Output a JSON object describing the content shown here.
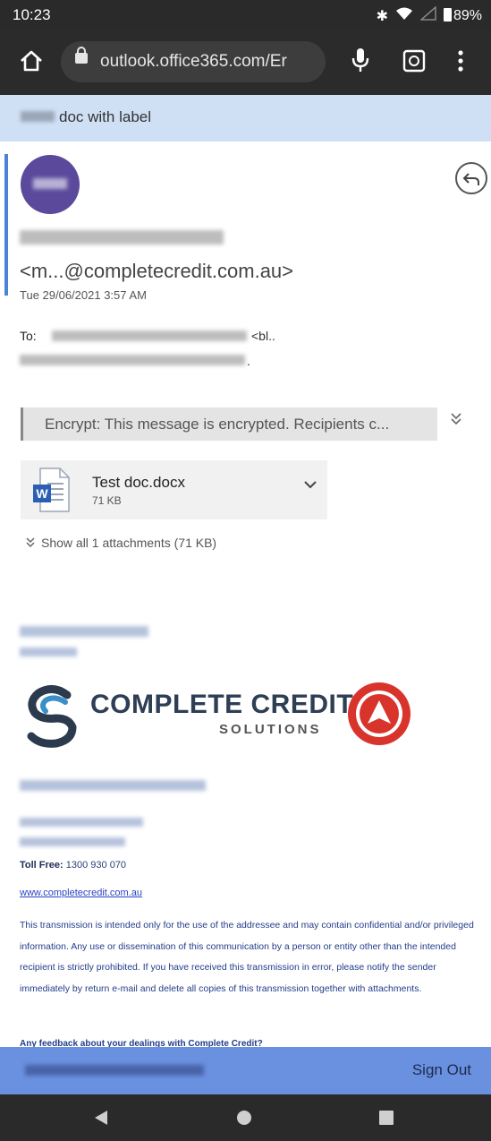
{
  "status_bar": {
    "time": "10:23",
    "battery": "89%",
    "icons": [
      "bluetooth-icon",
      "wifi-icon",
      "signal-icon",
      "battery-icon"
    ]
  },
  "browser": {
    "url": "outlook.office365.com/Er",
    "icons": [
      "home-icon",
      "lock-icon",
      "mic-icon",
      "tab-switcher-icon",
      "more-menu-icon"
    ]
  },
  "email": {
    "subject_suffix": "doc with label",
    "sender_email": "<m...@completecredit.com.au>",
    "date": "Tue 29/06/2021 3:57 AM",
    "to_label": "To:",
    "to_suffix": "<bl..",
    "to_trailing": ".",
    "encrypt_notice": "Encrypt: This message is encrypted. Recipients c...",
    "attachment": {
      "name": "Test doc.docx",
      "size": "71 KB"
    },
    "show_all": "Show all 1 attachments (71 KB)"
  },
  "signature": {
    "logo_line1": "COMPLETE CREDIT",
    "logo_line2": "SOLUTIONS",
    "toll_free_label": "Toll Free:",
    "toll_free_number": "1300 930 070",
    "website": "www.completecredit.com.au",
    "disclaimer": "This transmission is intended only for the use of the addressee and may contain confidential and/or privileged information. Any use or dissemination of this communication by a person or entity other than the intended recipient is strictly prohibited. If you have received this transmission in error, please notify the sender immediately by return e-mail and delete all copies of this transmission together with attachments.",
    "feedback": "Any feedback about your dealings with Complete Credit?"
  },
  "footer": {
    "sign_out": "Sign Out"
  },
  "colors": {
    "subject_bar": "#cfe0f5",
    "accent": "#4a84d4",
    "avatar": "#5b4a9c",
    "signout_bar": "#6a90e0",
    "logo_red": "#d8342c"
  }
}
